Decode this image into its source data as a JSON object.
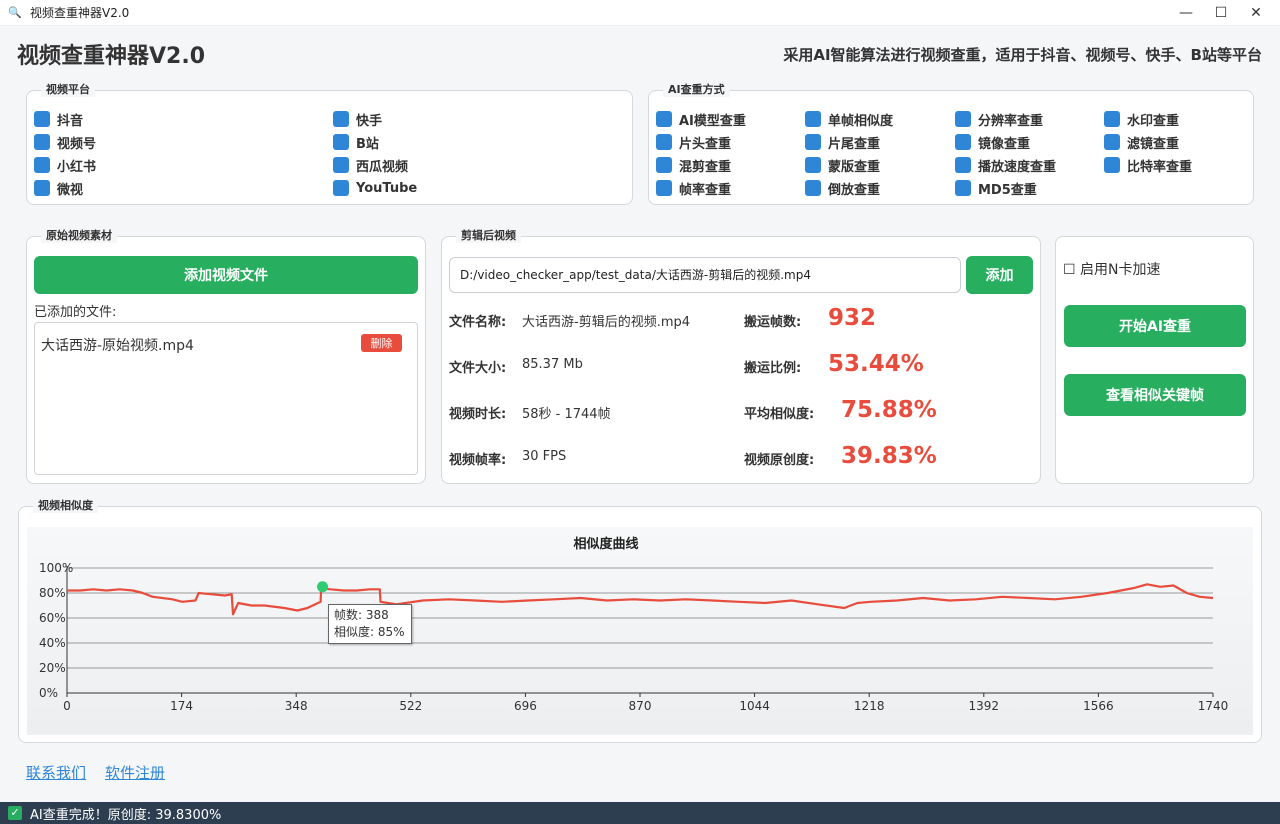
{
  "window": {
    "title": "视频查重神器V2.0",
    "controls": [
      "—",
      "☐",
      "✕"
    ]
  },
  "header": {
    "title": "视频查重神器V2.0",
    "subtitle": "采用AI智能算法进行视频查重，适用于抖音、视频号、快手、B站等平台"
  },
  "platforms": {
    "title": "视频平台",
    "items": [
      "抖音",
      "快手",
      "视频号",
      "B站",
      "小红书",
      "西瓜视频",
      "微视",
      "YouTube"
    ]
  },
  "methods": {
    "title": "AI查重方式",
    "items": [
      "AI模型查重",
      "单帧相似度",
      "分辨率查重",
      "水印查重",
      "片头查重",
      "片尾查重",
      "镜像查重",
      "滤镜查重",
      "混剪查重",
      "蒙版查重",
      "播放速度查重",
      "比特率查重",
      "帧率查重",
      "倒放查重",
      "MD5查重"
    ]
  },
  "source": {
    "title": "原始视频素材",
    "add_button": "添加视频文件",
    "files_label": "已添加的文件:",
    "file_name": "大话西游-原始视频.mp4",
    "delete_button": "删除"
  },
  "edited": {
    "title": "剪辑后视频",
    "path_value": "D:/video_checker_app/test_data/大话西游-剪辑后的视频.mp4",
    "add_button": "添加",
    "name_label": "文件名称:",
    "name_value": "大话西游-剪辑后的视频.mp4",
    "size_label": "文件大小:",
    "size_value": "85.37 Mb",
    "duration_label": "视频时长:",
    "duration_value": "58秒 - 1744帧",
    "fps_label": "视频帧率:",
    "fps_value": "30 FPS",
    "copied_frames_label": "搬运帧数:",
    "copied_frames_value": "932",
    "copy_ratio_label": "搬运比例:",
    "copy_ratio_value": "53.44%",
    "avg_sim_label": "平均相似度:",
    "avg_sim_value": "75.88%",
    "originality_label": "视频原创度:",
    "originality_value": "39.83%"
  },
  "actions": {
    "gpu_label": "☐ 启用N卡加速",
    "start_button": "开始AI查重",
    "keyframes_button": "查看相似关键帧"
  },
  "similarity": {
    "title": "视频相似度",
    "tooltip_frame": "帧数: 388",
    "tooltip_sim": "相似度: 85%"
  },
  "links": {
    "contact": "联系我们",
    "register": "软件注册"
  },
  "status": {
    "text": "AI查重完成！原创度: 39.8300%"
  },
  "colors": {
    "accent_green": "#27ae5f",
    "checkbox_blue": "#2f86d6",
    "alert_red": "#e74c3c",
    "line_red": "#e74c3c"
  },
  "chart_data": {
    "type": "line",
    "title": "相似度曲线",
    "x_ticks": [
      "0",
      "174",
      "348",
      "522",
      "696",
      "870",
      "1044",
      "1218",
      "1392",
      "1566",
      "1740"
    ],
    "y_ticks": [
      "0%",
      "20%",
      "40%",
      "60%",
      "80%",
      "100%"
    ],
    "xlim": [
      0,
      1740
    ],
    "ylim": [
      0,
      100
    ],
    "grid": true,
    "x": [
      0,
      20,
      40,
      60,
      80,
      100,
      115,
      130,
      145,
      160,
      175,
      195,
      200,
      220,
      240,
      250,
      252,
      260,
      280,
      300,
      330,
      350,
      365,
      385,
      386,
      400,
      420,
      440,
      460,
      475,
      476,
      500,
      540,
      580,
      620,
      660,
      700,
      740,
      780,
      820,
      860,
      900,
      940,
      980,
      1020,
      1060,
      1100,
      1140,
      1180,
      1200,
      1220,
      1260,
      1300,
      1340,
      1380,
      1420,
      1460,
      1500,
      1540,
      1580,
      1600,
      1620,
      1640,
      1660,
      1680,
      1700,
      1720,
      1740
    ],
    "values": [
      82,
      82,
      83,
      82,
      83,
      82,
      80,
      77,
      76,
      75,
      73,
      74,
      80,
      79,
      78,
      79,
      63,
      72,
      70,
      70,
      68,
      66,
      68,
      73,
      84,
      83,
      82,
      82,
      83,
      83,
      73,
      71,
      74,
      75,
      74,
      73,
      74,
      75,
      76,
      74,
      75,
      74,
      75,
      74,
      73,
      72,
      74,
      71,
      68,
      72,
      73,
      74,
      76,
      74,
      75,
      77,
      76,
      75,
      77,
      80,
      82,
      84,
      87,
      85,
      86,
      80,
      77,
      76
    ]
  }
}
